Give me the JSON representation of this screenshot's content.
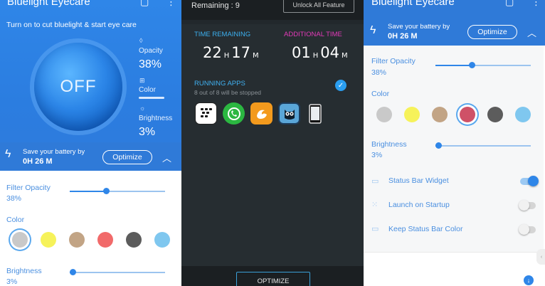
{
  "panel1": {
    "app_title": "Bluelight Eyecare",
    "subtitle": "Turn on to cut bluelight & start eye care",
    "power_label": "OFF",
    "opacity_label": "Opacity",
    "opacity_value": "38%",
    "color_label": "Color",
    "brightness_label": "Brightness",
    "brightness_value": "3%",
    "save_label": "Save your battery by",
    "save_time": "0H 26 M",
    "optimize_label": "Optimize",
    "filter_opacity_label": "Filter Opacity",
    "filter_opacity_value": "38%",
    "filter_opacity_level": 0.38,
    "color_section_label": "Color",
    "brightness_section_label": "Brightness",
    "brightness_section_value": "3%",
    "brightness_level": 0.03,
    "swatches": [
      "#c9c9c9",
      "#f6f25a",
      "#c2a485",
      "#f16a6a",
      "#5c5c5c",
      "#7fc7ef"
    ],
    "selected_swatch": 0
  },
  "panel2": {
    "remaining_label": "Remaining : 9",
    "unlock_label": "Unlock All Feature",
    "time_remaining_label": "TIME REMAINING",
    "additional_time_label": "ADDITIONAL TIME",
    "time_remaining": {
      "h": "22",
      "h_unit": "H",
      "m": "17",
      "m_unit": "M"
    },
    "additional_time": {
      "h": "01",
      "h_unit": "H",
      "m": "04",
      "m_unit": "M"
    },
    "running_apps_label": "RUNNING APPS",
    "running_apps_sub": "8 out of 8 will be stopped",
    "apps": [
      "bbm-icon",
      "whatsapp-icon",
      "uc-browser-icon",
      "owl-app-icon",
      "phone-icon"
    ],
    "optimize_label": "OPTIMIZE",
    "accent_blue": "#3cb0f0",
    "accent_pink": "#e23ab8"
  },
  "panel3": {
    "app_title": "Bluelight Eyecare",
    "save_label": "Save your battery by",
    "save_time": "0H 26 M",
    "optimize_label": "Optimize",
    "filter_opacity_label": "Filter Opacity",
    "filter_opacity_value": "38%",
    "filter_opacity_level": 0.38,
    "color_section_label": "Color",
    "swatches": [
      "#c9c9c9",
      "#f6f25a",
      "#c2a485",
      "#cf5167",
      "#5c5c5c",
      "#7fc7ef"
    ],
    "selected_swatch": 3,
    "brightness_section_label": "Brightness",
    "brightness_section_value": "3%",
    "brightness_level": 0.03,
    "options": [
      {
        "label": "Status Bar Widget",
        "on": true
      },
      {
        "label": "Launch on Startup",
        "on": false
      },
      {
        "label": "Keep Status Bar Color",
        "on": false
      }
    ]
  }
}
